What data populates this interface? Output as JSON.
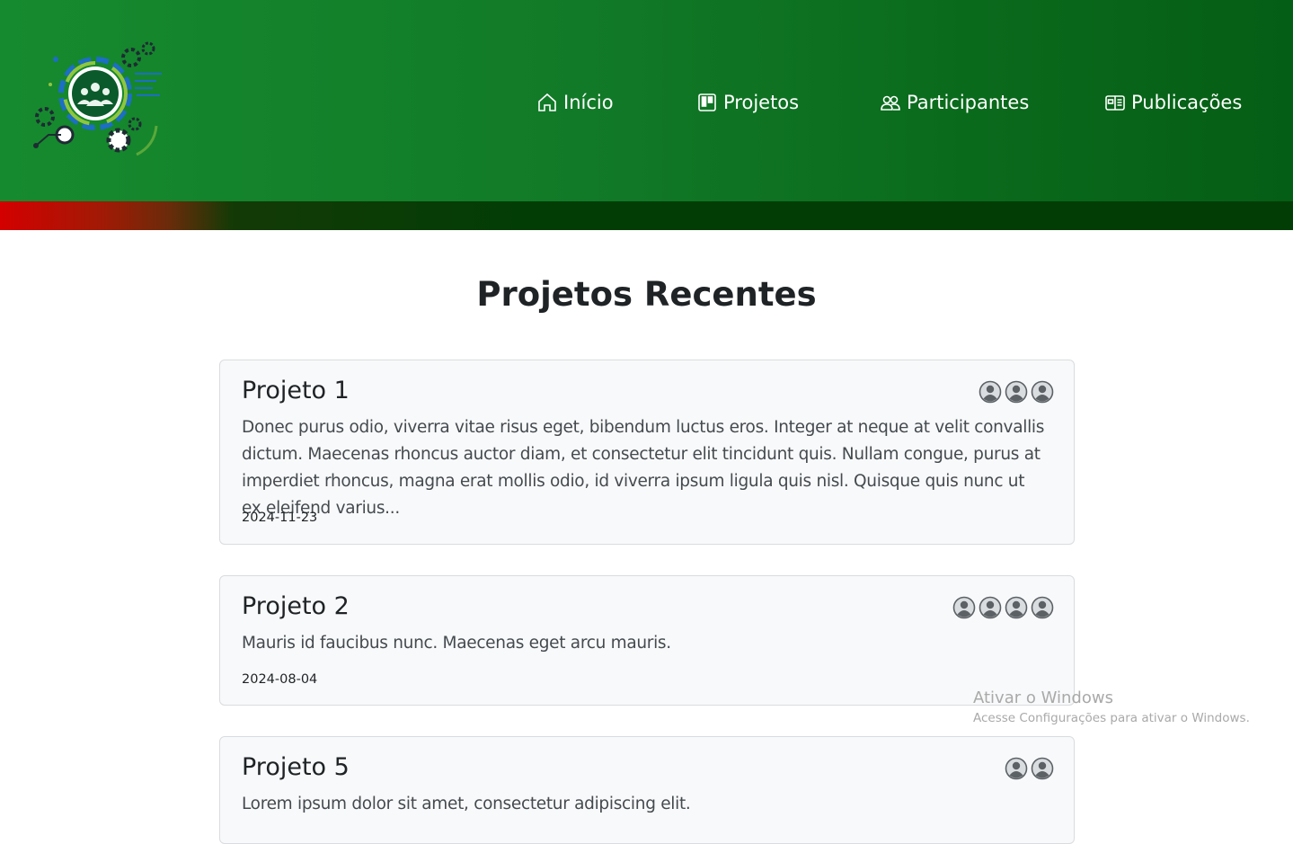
{
  "nav": {
    "items": [
      {
        "label": "Início",
        "icon": "house-icon"
      },
      {
        "label": "Projetos",
        "icon": "kanban-icon"
      },
      {
        "label": "Participantes",
        "icon": "people-icon"
      },
      {
        "label": "Publicações",
        "icon": "newspaper-icon"
      }
    ]
  },
  "logo": {
    "icon": "team-gears-logo"
  },
  "main": {
    "title": "Projetos Recentes",
    "projects": [
      {
        "title": "Projeto 1",
        "participants": 3,
        "description": "Donec purus odio, viverra vitae risus eget, bibendum luctus eros. Integer at neque at velit convallis dictum. Maecenas rhoncus auctor diam, et consectetur elit tincidunt quis. Nullam congue, purus at imperdiet rhoncus, magna erat mollis odio, id viverra ipsum ligula quis nisl. Quisque quis nunc ut ex eleifend varius...",
        "date": "2024-11-23"
      },
      {
        "title": "Projeto 2",
        "participants": 4,
        "description": "Mauris id faucibus nunc. Maecenas eget arcu mauris.",
        "date": "2024-08-04"
      },
      {
        "title": "Projeto 5",
        "participants": 2,
        "description": "Lorem ipsum dolor sit amet, consectetur adipiscing elit.",
        "date": ""
      }
    ]
  },
  "watermark": {
    "title": "Ativar o Windows",
    "subtitle": "Acesse Configurações para ativar o Windows."
  },
  "colors": {
    "header_green": "#117a28",
    "accent_red": "#d40000",
    "dark_green": "#033d06",
    "card_bg": "#f8f9fa"
  }
}
